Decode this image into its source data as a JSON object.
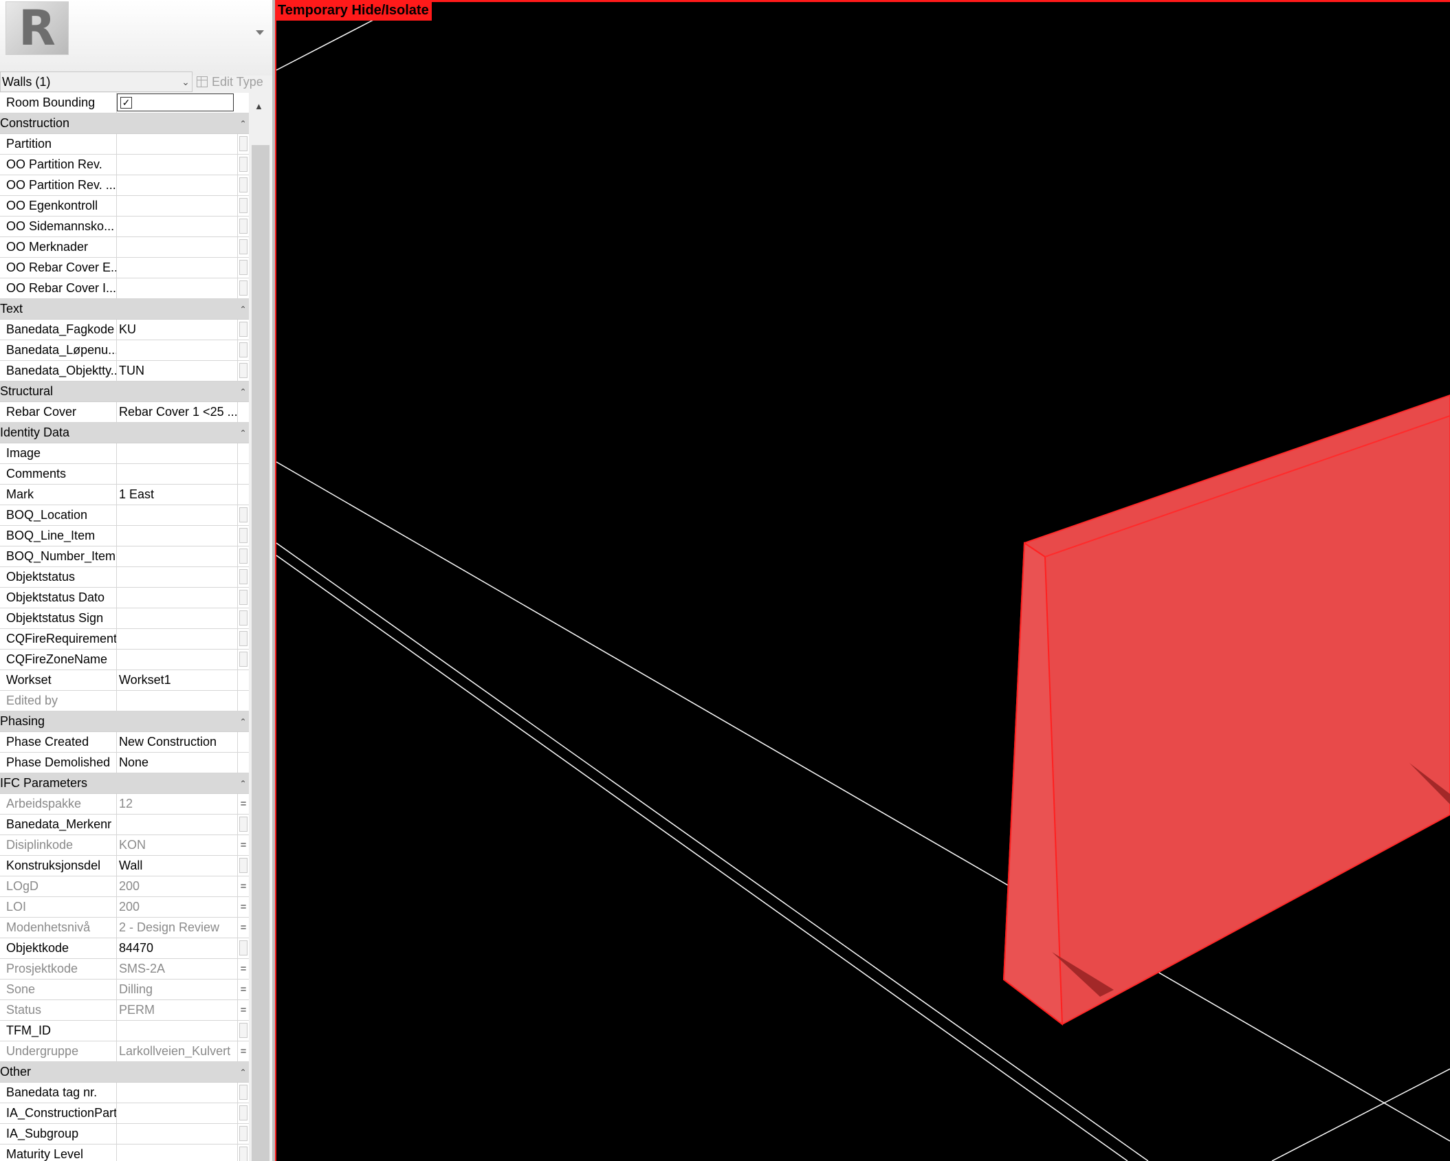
{
  "palette": {
    "logo_letter": "R",
    "type_selector": "Walls (1)",
    "edit_type": "Edit Type",
    "room_bounding": {
      "name": "Room Bounding",
      "checked": true,
      "check_glyph": "✓"
    }
  },
  "groups": [
    {
      "title": "Construction",
      "rows": [
        {
          "name": "Partition",
          "value": "",
          "btn": "box"
        },
        {
          "name": "OO Partition Rev.",
          "value": "",
          "btn": "box"
        },
        {
          "name": "OO Partition Rev. ...",
          "value": "",
          "btn": "box"
        },
        {
          "name": "OO Egenkontroll",
          "value": "",
          "btn": "box"
        },
        {
          "name": "OO Sidemannsko...",
          "value": "",
          "btn": "box"
        },
        {
          "name": "OO Merknader",
          "value": "",
          "btn": "box"
        },
        {
          "name": "OO Rebar Cover E...",
          "value": "",
          "btn": "box"
        },
        {
          "name": "OO Rebar Cover I...",
          "value": "",
          "btn": "box"
        }
      ]
    },
    {
      "title": "Text",
      "rows": [
        {
          "name": "Banedata_Fagkode",
          "value": "KU",
          "btn": "box"
        },
        {
          "name": "Banedata_Løpenu...",
          "value": "",
          "btn": "box"
        },
        {
          "name": "Banedata_Objektty...",
          "value": "TUN",
          "btn": "box"
        }
      ]
    },
    {
      "title": "Structural",
      "rows": [
        {
          "name": "Rebar Cover",
          "value": "Rebar Cover 1 <25 ...",
          "btn": "none"
        }
      ]
    },
    {
      "title": "Identity Data",
      "rows": [
        {
          "name": "Image",
          "value": "",
          "btn": "none"
        },
        {
          "name": "Comments",
          "value": "",
          "btn": "none"
        },
        {
          "name": "Mark",
          "value": "1 East",
          "btn": "none"
        },
        {
          "name": "BOQ_Location",
          "value": "",
          "btn": "box"
        },
        {
          "name": "BOQ_Line_Item",
          "value": "",
          "btn": "box"
        },
        {
          "name": "BOQ_Number_Item",
          "value": "",
          "btn": "box"
        },
        {
          "name": "Objektstatus",
          "value": "",
          "btn": "box"
        },
        {
          "name": "Objektstatus Dato",
          "value": "",
          "btn": "box"
        },
        {
          "name": "Objektstatus Sign",
          "value": "",
          "btn": "box"
        },
        {
          "name": "CQFireRequirement",
          "value": "",
          "btn": "box"
        },
        {
          "name": "CQFireZoneName",
          "value": "",
          "btn": "box"
        },
        {
          "name": "Workset",
          "value": "Workset1",
          "btn": "none"
        },
        {
          "name": "Edited by",
          "value": "",
          "btn": "none",
          "dim": true
        }
      ]
    },
    {
      "title": "Phasing",
      "rows": [
        {
          "name": "Phase Created",
          "value": "New Construction",
          "btn": "none"
        },
        {
          "name": "Phase Demolished",
          "value": "None",
          "btn": "none"
        }
      ]
    },
    {
      "title": "IFC Parameters",
      "rows": [
        {
          "name": "Arbeidspakke",
          "value": "12",
          "btn": "eq",
          "dim": true
        },
        {
          "name": "Banedata_Merkenr",
          "value": "",
          "btn": "box"
        },
        {
          "name": "Disiplinkode",
          "value": "KON",
          "btn": "eq",
          "dim": true
        },
        {
          "name": "Konstruksjonsdel",
          "value": "Wall",
          "btn": "box"
        },
        {
          "name": "LOgD",
          "value": "200",
          "btn": "eq",
          "dim": true
        },
        {
          "name": "LOI",
          "value": "200",
          "btn": "eq",
          "dim": true
        },
        {
          "name": "Modenhetsnivå",
          "value": "2 - Design Review",
          "btn": "eq",
          "dim": true
        },
        {
          "name": "Objektkode",
          "value": "84470",
          "btn": "box"
        },
        {
          "name": "Prosjektkode",
          "value": "SMS-2A",
          "btn": "eq",
          "dim": true
        },
        {
          "name": "Sone",
          "value": "Dilling",
          "btn": "eq",
          "dim": true
        },
        {
          "name": "Status",
          "value": "PERM",
          "btn": "eq",
          "dim": true
        },
        {
          "name": "TFM_ID",
          "value": "",
          "btn": "box"
        },
        {
          "name": "Undergruppe",
          "value": "Larkollveien_Kulvert",
          "btn": "eq",
          "dim": true
        }
      ]
    },
    {
      "title": "Other",
      "rows": [
        {
          "name": "Banedata tag nr.",
          "value": "",
          "btn": "box"
        },
        {
          "name": "IA_ConstructionPart",
          "value": "",
          "btn": "box"
        },
        {
          "name": "IA_Subgroup",
          "value": "",
          "btn": "box"
        },
        {
          "name": "Maturity Level",
          "value": "",
          "btn": "box"
        }
      ]
    }
  ],
  "collapse_glyph": "⌃",
  "viewport": {
    "badge": "Temporary Hide/Isolate",
    "highlight_color": "#e84a4a",
    "frame_color": "#ff1a1a"
  }
}
